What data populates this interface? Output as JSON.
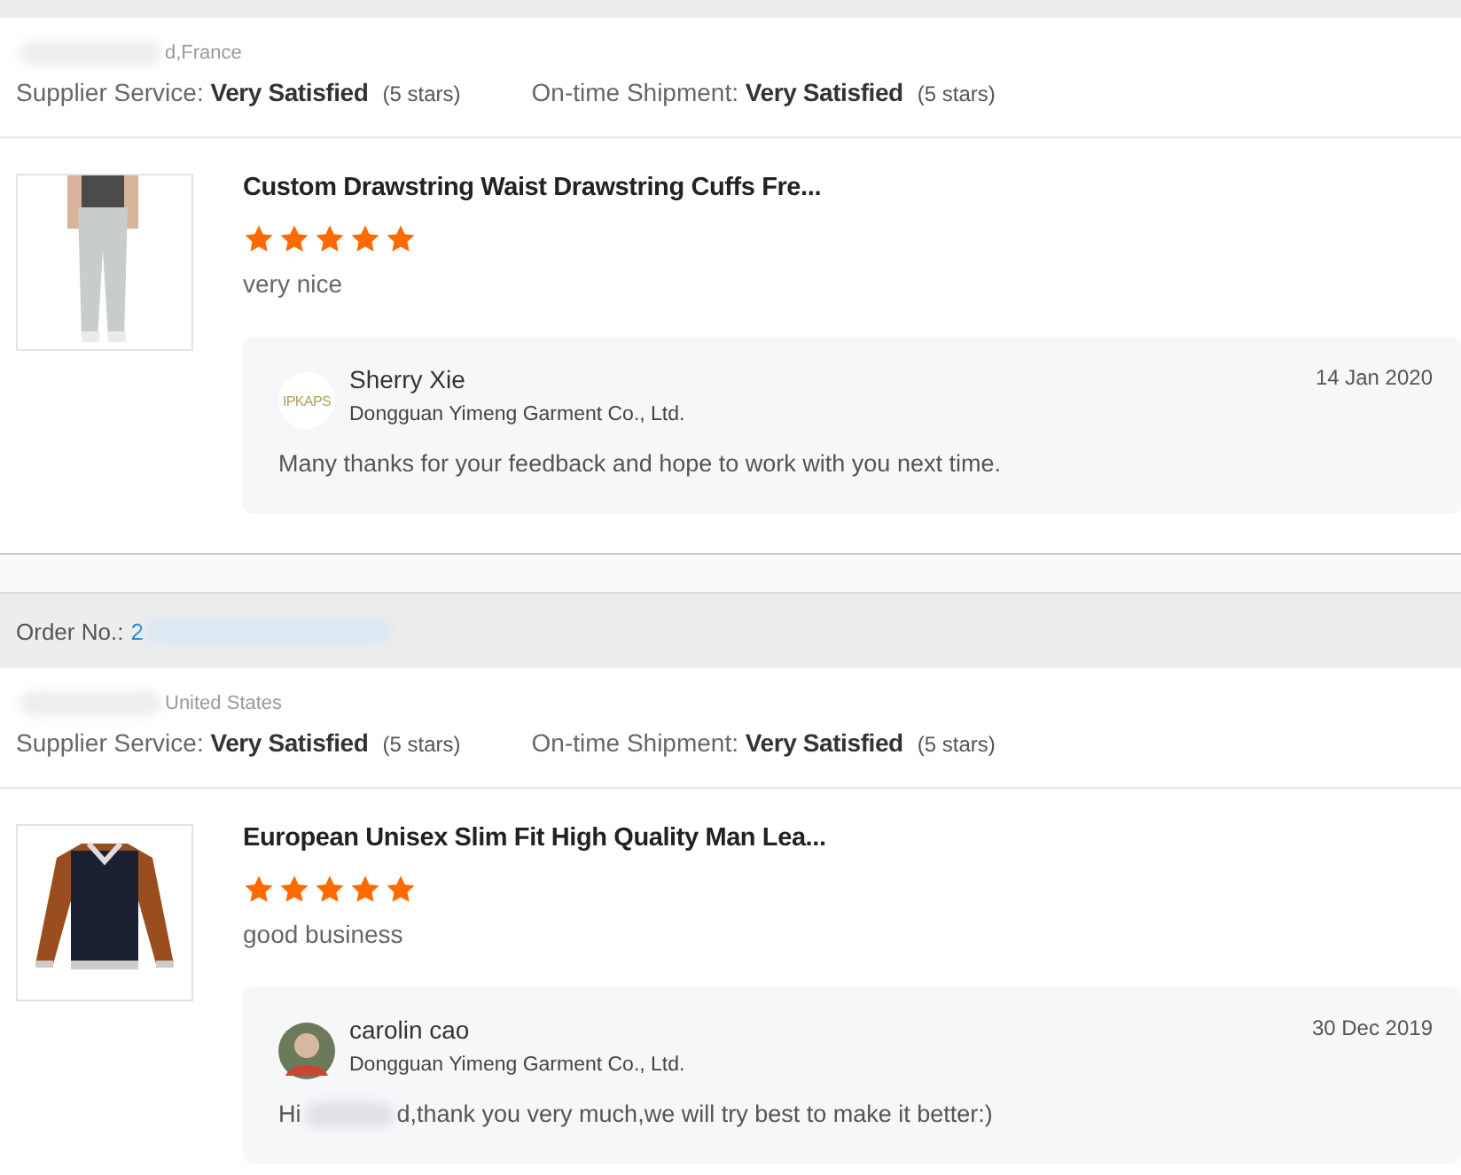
{
  "orders": [
    {
      "buyer_location": "d,France",
      "ratings": [
        {
          "label": "Supplier Service:",
          "value": "Very Satisfied",
          "stars_text": "(5 stars)"
        },
        {
          "label": "On-time Shipment:",
          "value": "Very Satisfied",
          "stars_text": "(5 stars)"
        }
      ],
      "product": {
        "kind": "pants",
        "title": "Custom Drawstring Waist Drawstring Cuffs Fre...",
        "stars": 5,
        "comment": "very nice"
      },
      "reply": {
        "avatar": {
          "kind": "logo",
          "text": "IPKAPS"
        },
        "name": "Sherry Xie",
        "company": "Dongguan Yimeng Garment Co., Ltd.",
        "date": "14 Jan 2020",
        "message": [
          "Many thanks for your feedback and hope to work with you next time."
        ]
      }
    },
    {
      "order_label": "Order No.:",
      "order_no": "2",
      "buyer_location": "United States",
      "ratings": [
        {
          "label": "Supplier Service:",
          "value": "Very Satisfied",
          "stars_text": "(5 stars)"
        },
        {
          "label": "On-time Shipment:",
          "value": "Very Satisfied",
          "stars_text": "(5 stars)"
        }
      ],
      "product": {
        "kind": "jacket",
        "title": "European Unisex Slim Fit High Quality Man Lea...",
        "stars": 5,
        "comment": "good business"
      },
      "reply": {
        "name": "carolin cao",
        "company": "Dongguan Yimeng Garment Co., Ltd.",
        "date": "30 Dec 2019",
        "message": [
          "Hi",
          "d,thank you very much,we will try best to make it better:)"
        ]
      }
    }
  ]
}
